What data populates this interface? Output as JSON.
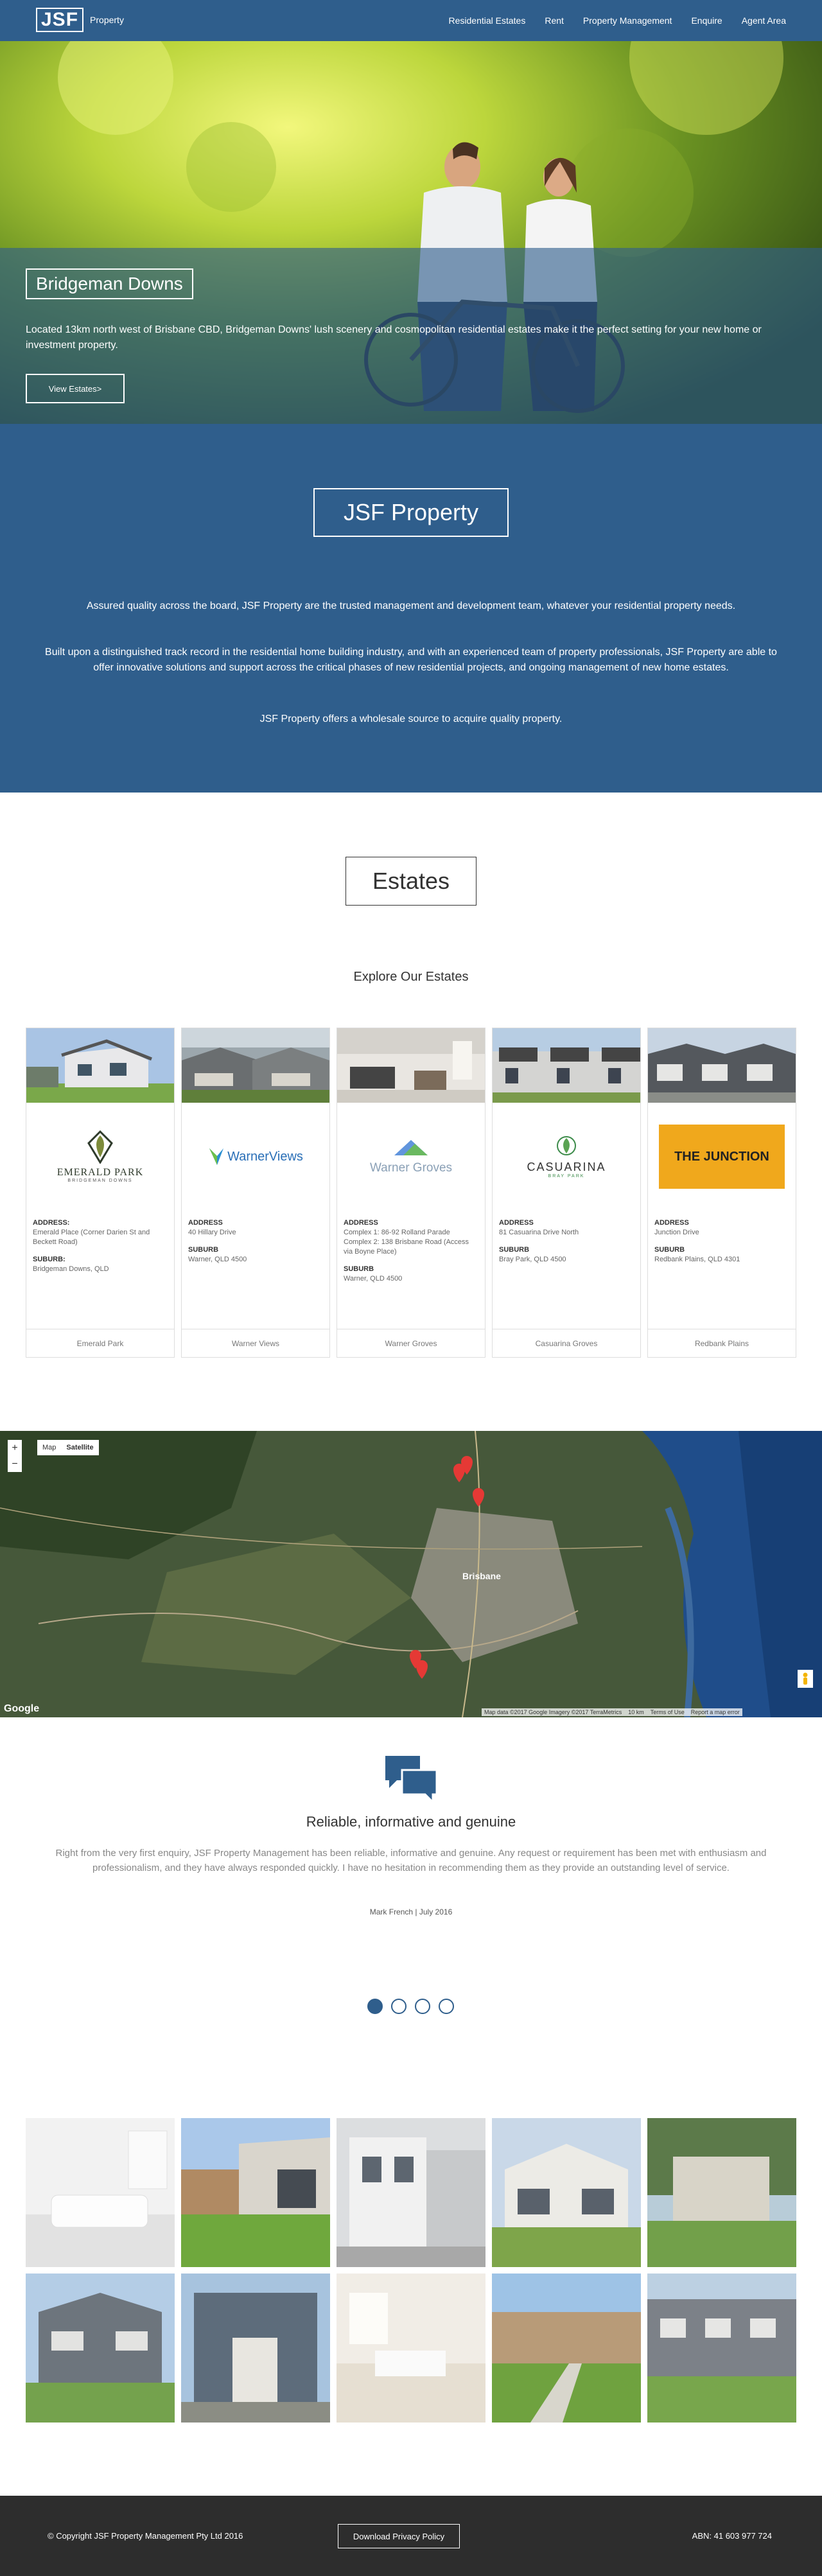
{
  "nav": {
    "logo": "JSF",
    "logo_sub": "Property",
    "links": [
      "Residential Estates",
      "Rent",
      "Property Management",
      "Enquire",
      "Agent Area"
    ]
  },
  "hero": {
    "title": "Bridgeman Downs",
    "description": "Located 13km north west of Brisbane CBD, Bridgeman Downs' lush scenery and cosmopolitan residential estates make it the perfect setting for your new home or investment property.",
    "button": "View Estates>"
  },
  "about": {
    "title": "JSF Property",
    "paragraphs": [
      "Assured quality across the board, JSF Property are the trusted management and development team, whatever your residential property needs.",
      "Built upon a distinguished track record in the residential home building industry, and with an experienced team of property professionals, JSF Property are able to offer innovative solutions and support across the critical phases of new residential projects, and ongoing management of new home estates.",
      "JSF Property offers a wholesale source to acquire quality property."
    ]
  },
  "estates": {
    "title": "Estates",
    "subtitle": "Explore Our Estates",
    "cards": [
      {
        "logo_main": "EMERALD PARK",
        "logo_sub": "BRIDGEMAN DOWNS",
        "label1": "ADDRESS:",
        "address": "Emerald Place (Corner Darien St and Beckett Road)",
        "label2": "SUBURB:",
        "suburb": "Bridgeman Downs, QLD",
        "footer": "Emerald Park"
      },
      {
        "logo_main": "WarnerViews",
        "logo_sub": "",
        "label1": "ADDRESS",
        "address": "40 Hillary Drive",
        "label2": "SUBURB",
        "suburb": "Warner, QLD 4500",
        "footer": "Warner Views"
      },
      {
        "logo_main": "Warner Groves",
        "logo_sub": "",
        "label1": "ADDRESS",
        "address": "Complex 1: 86-92 Rolland Parade Complex 2: 138 Brisbane Road (Access via Boyne Place)",
        "label2": "SUBURB",
        "suburb": "Warner, QLD 4500",
        "footer": "Warner Groves"
      },
      {
        "logo_main": "CASUARINA",
        "logo_sub": "BRAY PARK",
        "label1": "ADDRESS",
        "address": "81 Casuarina Drive North",
        "label2": "SUBURB",
        "suburb": "Bray Park, QLD 4500",
        "footer": "Casuarina Groves"
      },
      {
        "logo_main": "THE JUNCTION",
        "logo_sub": "",
        "label1": "ADDRESS",
        "address": "Junction Drive",
        "label2": "SUBURB",
        "suburb": "Redbank Plains, QLD 4301",
        "footer": "Redbank Plains"
      }
    ]
  },
  "map": {
    "type_map": "Map",
    "type_satellite": "Satellite",
    "zoom_in": "+",
    "zoom_out": "−",
    "city": "Brisbane",
    "google": "Google",
    "attribution": "Map data ©2017 Google Imagery ©2017 TerraMetrics",
    "scale": "10 km",
    "terms": "Terms of Use",
    "report": "Report a map error"
  },
  "testimonial": {
    "title": "Reliable, informative and genuine",
    "quote": "Right from the very first enquiry, JSF Property Management has been reliable, informative and genuine. Any request or requirement has been met with enthusiasm and professionalism, and they have always responded quickly. I have no hesitation in recommending them as they provide an outstanding level of service.",
    "author": "Mark French | July 2016"
  },
  "footer": {
    "copyright": "© Copyright JSF Property Management Pty Ltd 2016",
    "privacy": "Download Privacy Policy",
    "abn": "ABN: 41 603 977 724"
  },
  "colors": {
    "brand_blue": "#2f5e8c",
    "footer_dark": "#2d2d2d",
    "junction_orange": "#f0a81c"
  }
}
